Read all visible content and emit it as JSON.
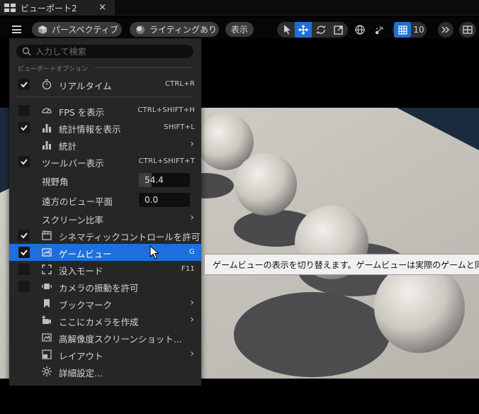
{
  "tab": {
    "title": "ビューポート2",
    "close": "×"
  },
  "toolbar": {
    "perspective_label": "パースペクティブ",
    "lighting_label": "ライティングあり",
    "show_label": "表示",
    "grid_value": "10"
  },
  "menu": {
    "search_placeholder": "入力して検索",
    "section_label": "ビューポートオプション",
    "items": [
      {
        "label": "リアルタイム",
        "shortcut": "CTRL+R",
        "checked": true,
        "icon": "stopwatch-icon"
      },
      {
        "label": "FPS を表示",
        "shortcut": "CTRL+SHIFT+H",
        "checked": false,
        "icon": "gauge-icon"
      },
      {
        "label": "統計情報を表示",
        "shortcut": "SHIFT+L",
        "checked": true,
        "icon": "bar-chart-icon"
      },
      {
        "label": "統計",
        "submenu": true,
        "icon": "bar-chart-icon"
      },
      {
        "label": "ツールバー表示",
        "shortcut": "CTRL+SHIFT+T",
        "checked": true
      },
      {
        "label": "視野角",
        "value": "54.4",
        "fill_fraction": 0.25
      },
      {
        "label": "遠方のビュー平面",
        "value": "0.0",
        "fill_fraction": 0
      },
      {
        "label": "スクリーン比率",
        "submenu": true
      },
      {
        "label": "シネマティックコントロールを許可",
        "checked": true,
        "icon": "clapperboard-icon"
      },
      {
        "label": "ゲームビュー",
        "shortcut": "G",
        "checked": true,
        "icon": "game-view-icon",
        "highlighted": true
      },
      {
        "label": "没入モード",
        "shortcut": "F11",
        "checked": false,
        "icon": "fullscreen-icon"
      },
      {
        "label": "カメラの振動を許可",
        "checked": false,
        "icon": "camera-shake-icon"
      },
      {
        "label": "ブックマーク",
        "submenu": true,
        "icon": "bookmark-icon"
      },
      {
        "label": "ここにカメラを作成",
        "submenu": true,
        "icon": "camera-add-icon"
      },
      {
        "label": "高解像度スクリーンショット...",
        "icon": "screenshot-icon"
      },
      {
        "label": "レイアウト",
        "submenu": true,
        "icon": "layout-icon"
      },
      {
        "label": "詳細設定...",
        "icon": "gear-icon"
      }
    ]
  },
  "tooltip": {
    "text": "ゲームビューの表示を切り替えます。ゲームビューは実際のゲームと同様の"
  },
  "colors": {
    "highlight": "#1d6fdd",
    "menu_bg": "#262626",
    "tooltip_bg": "#f0f0f0"
  }
}
